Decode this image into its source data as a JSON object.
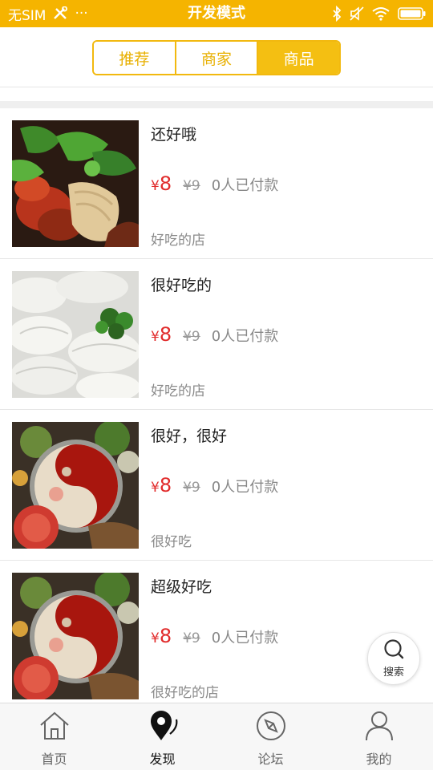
{
  "status_bar": {
    "carrier": "无SIM",
    "dots": "···",
    "title": "开发模式"
  },
  "tabs": [
    {
      "label": "推荐",
      "active": false
    },
    {
      "label": "商家",
      "active": false
    },
    {
      "label": "商品",
      "active": true
    }
  ],
  "products": [
    {
      "name": "还好哦",
      "currency": "¥",
      "price": "8",
      "old_price": "¥9",
      "sold": "0人已付款",
      "shop": "好吃的店",
      "image": "salad-noodles"
    },
    {
      "name": "很好吃的",
      "currency": "¥",
      "price": "8",
      "old_price": "¥9",
      "sold": "0人已付款",
      "shop": "好吃的店",
      "image": "dumplings"
    },
    {
      "name": "很好，很好",
      "currency": "¥",
      "price": "8",
      "old_price": "¥9",
      "sold": "0人已付款",
      "shop": "很好吃",
      "image": "hotpot"
    },
    {
      "name": "超级好吃",
      "currency": "¥",
      "price": "8",
      "old_price": "¥9",
      "sold": "0人已付款",
      "shop": "很好吃的店",
      "image": "hotpot"
    }
  ],
  "search_button": {
    "label": "搜索",
    "icon": "search-icon"
  },
  "bottom_nav": [
    {
      "label": "首页",
      "icon": "home-icon",
      "active": false
    },
    {
      "label": "发现",
      "icon": "discover-pin-icon",
      "active": true
    },
    {
      "label": "论坛",
      "icon": "compass-icon",
      "active": false
    },
    {
      "label": "我的",
      "icon": "user-icon",
      "active": false
    }
  ],
  "colors": {
    "brand_yellow": "#f5b400",
    "price_red": "#e12b2b"
  }
}
